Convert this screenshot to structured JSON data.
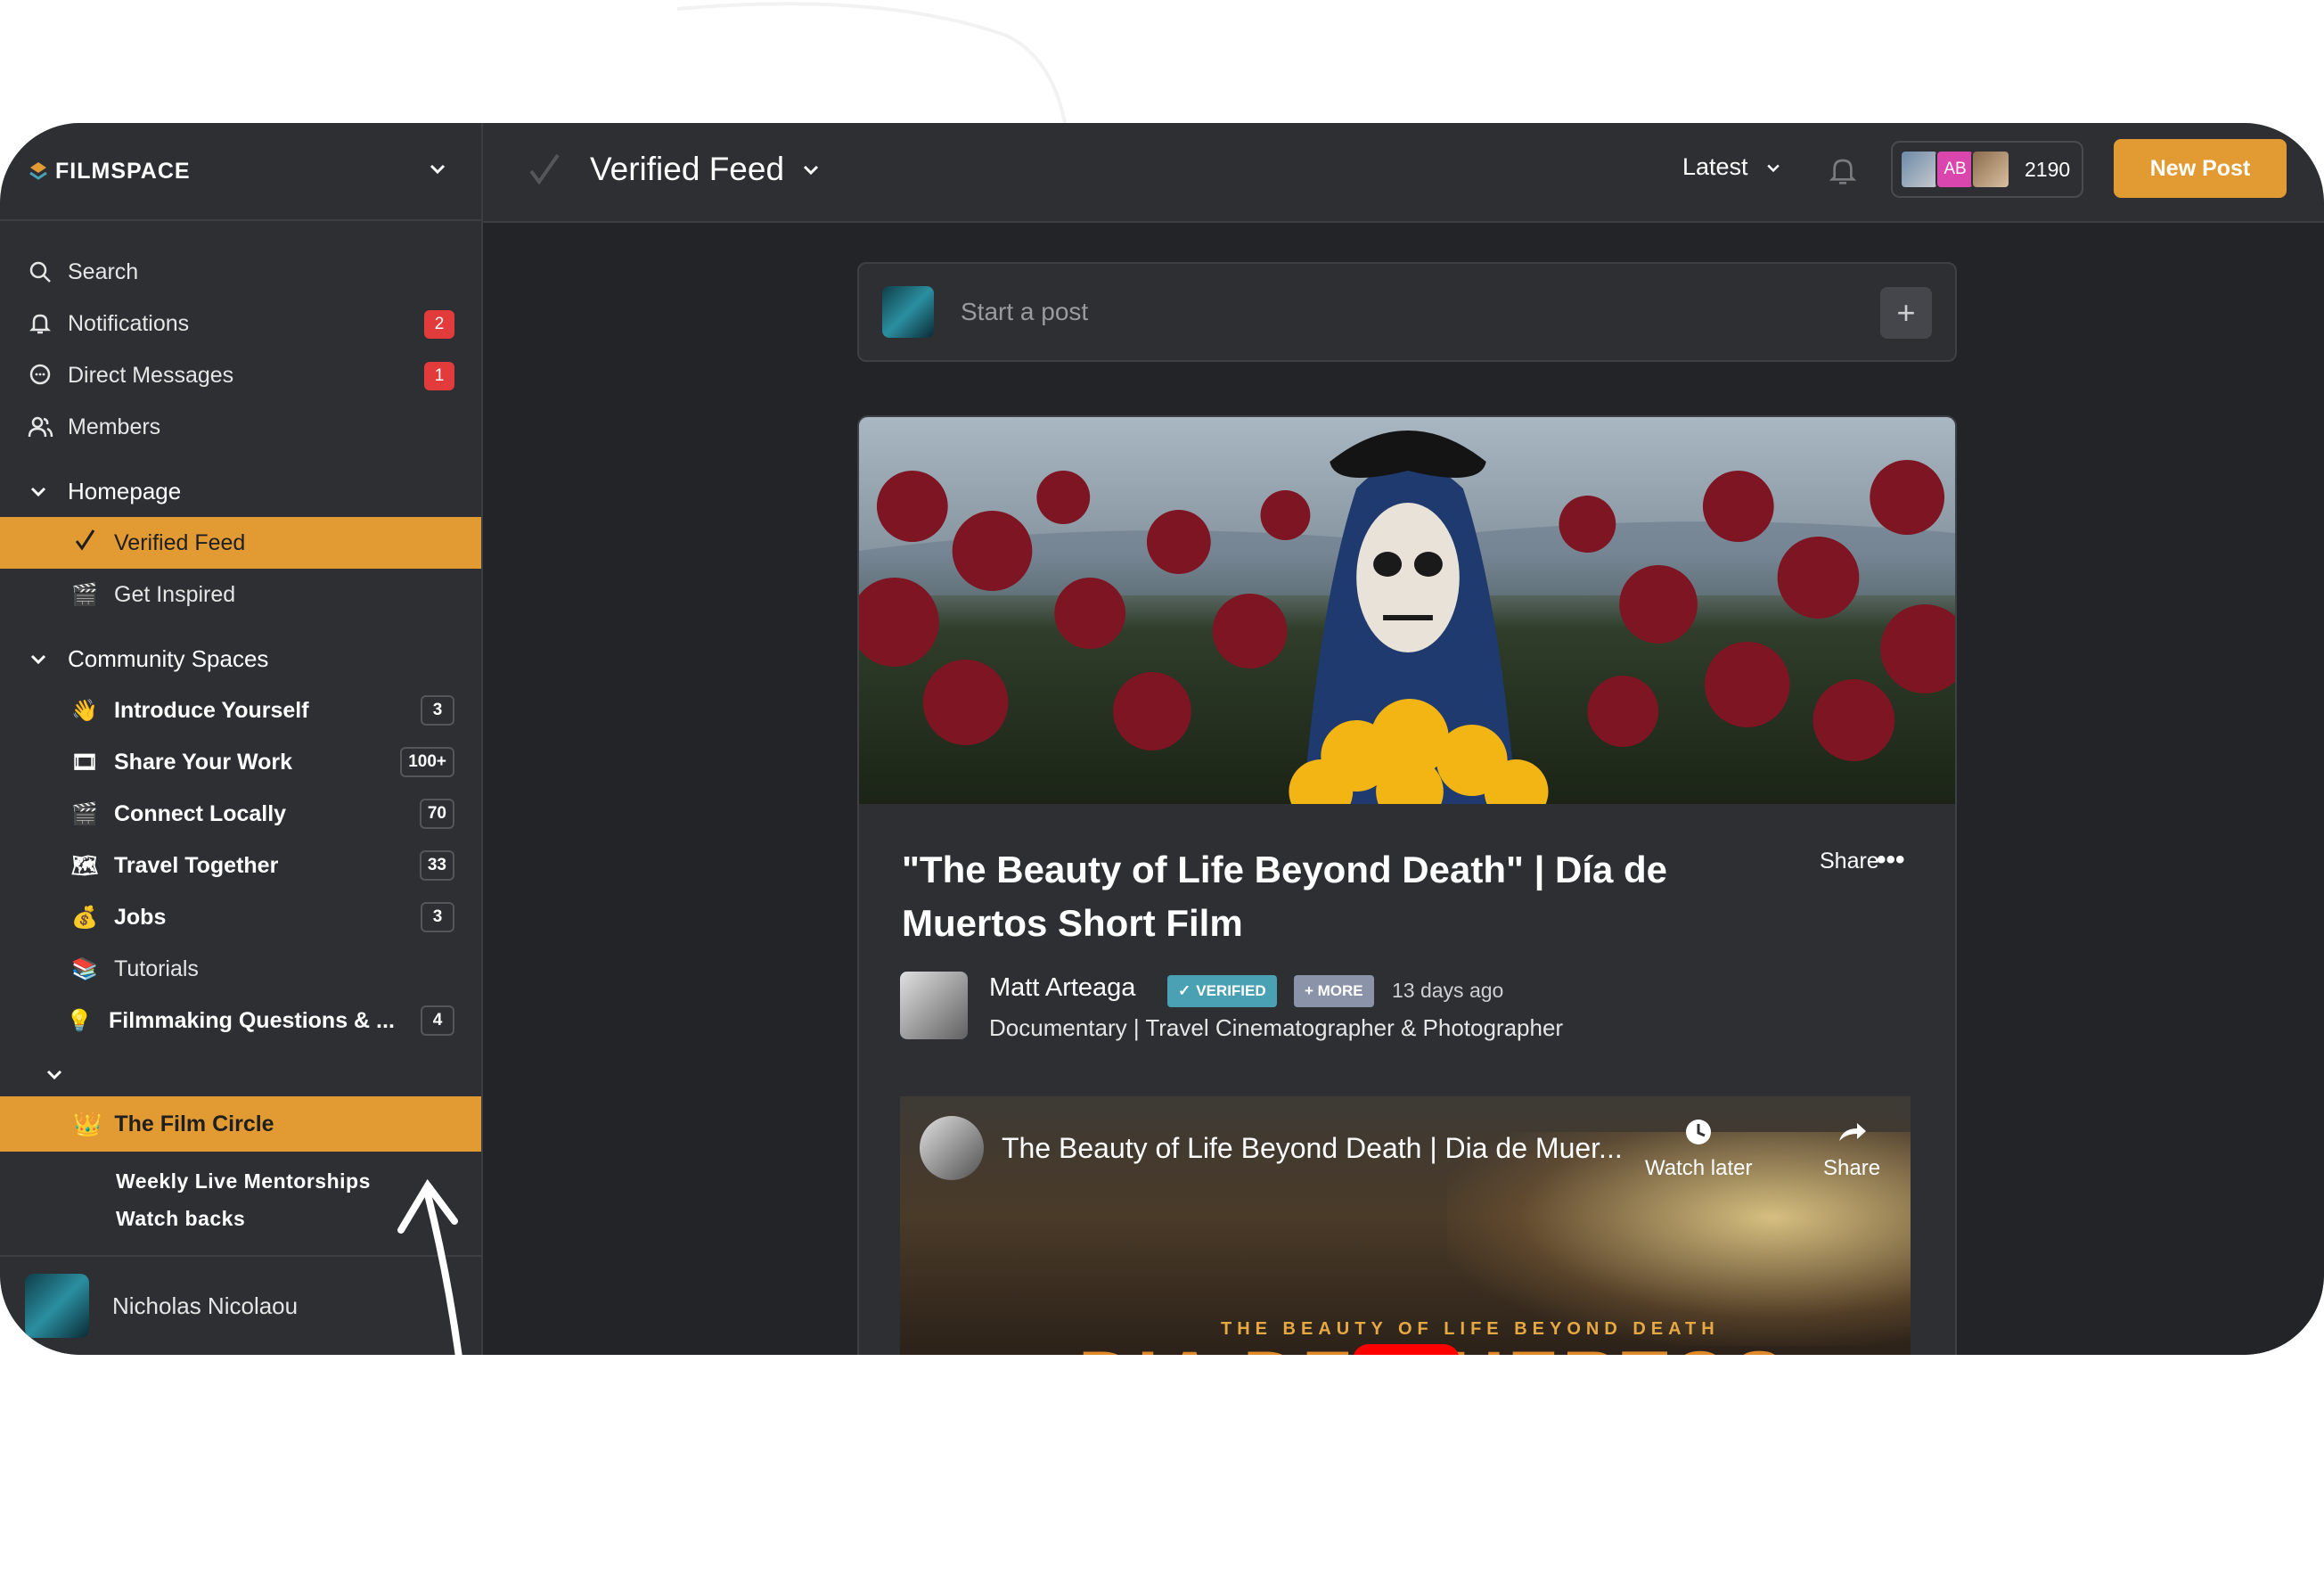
{
  "brand": {
    "name": "FILMSPACE"
  },
  "sidebar": {
    "nav": [
      {
        "label": "Search",
        "icon": "search-icon"
      },
      {
        "label": "Notifications",
        "icon": "bell-icon",
        "badge": "2"
      },
      {
        "label": "Direct Messages",
        "icon": "chat-icon",
        "badge": "1"
      },
      {
        "label": "Members",
        "icon": "members-icon"
      }
    ],
    "homepage": {
      "title": "Homepage",
      "items": [
        {
          "label": "Verified Feed",
          "icon": "check-icon"
        },
        {
          "label": "Get Inspired",
          "icon": "clapper-icon"
        }
      ]
    },
    "community": {
      "title": "Community Spaces",
      "items": [
        {
          "label": "Introduce Yourself",
          "emoji": "👋",
          "count": "3"
        },
        {
          "label": "Share Your Work",
          "emoji": "🎞",
          "count": "100+"
        },
        {
          "label": "Connect Locally",
          "emoji": "🎬",
          "count": "70"
        },
        {
          "label": "Travel Together",
          "emoji": "🗺",
          "count": "33"
        },
        {
          "label": "Jobs",
          "emoji": "💰",
          "count": "3"
        },
        {
          "label": "Tutorials",
          "emoji": "📚"
        },
        {
          "label": "Filmmaking Questions & ...",
          "emoji": "💡",
          "count": "4"
        }
      ]
    },
    "circle": {
      "label": "The Film Circle",
      "emoji": "👑",
      "lines": [
        "Weekly Live Mentorships",
        "Watch backs"
      ]
    },
    "user": {
      "name": "Nicholas Nicolaou"
    }
  },
  "topbar": {
    "title": "Verified Feed",
    "sort": "Latest",
    "member_avatar_initials": "AB",
    "member_count": "2190",
    "new_post": "New Post"
  },
  "composer": {
    "placeholder": "Start a post"
  },
  "post": {
    "title": "\"The Beauty of Life Beyond Death\" | Día de Muertos Short Film",
    "share": "Share",
    "author": "Matt Arteaga",
    "badge_verified": "VERIFIED",
    "badge_more": "+ MORE",
    "time": "13 days ago",
    "headline": "Documentary | Travel Cinematographer & Photographer",
    "video": {
      "title": "The Beauty of Life Beyond Death | Dia de Muer...",
      "watch_later": "Watch later",
      "share": "Share",
      "caption": "THE BEAUTY OF LIFE BEYOND DEATH",
      "big_text": "DIA DE MUERTOS"
    }
  },
  "colors": {
    "accent": "#e29b33",
    "badge_red": "#e23b3b",
    "verified": "#4aa1b4"
  }
}
